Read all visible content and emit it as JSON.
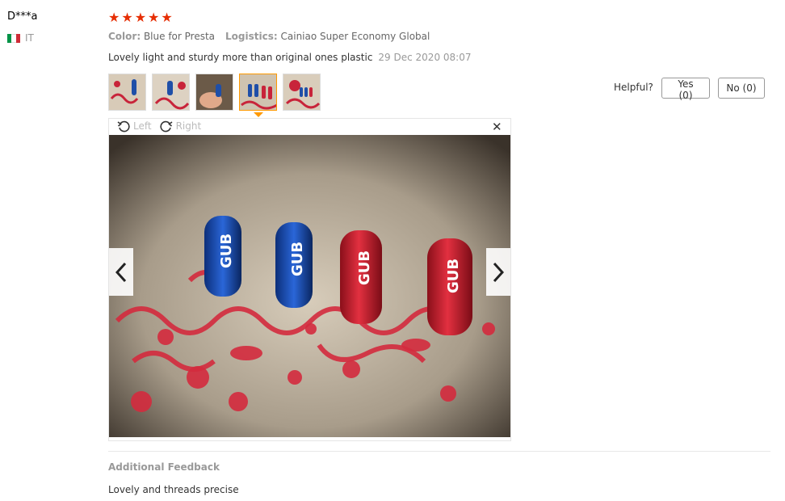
{
  "reviewer": {
    "name": "D***a",
    "country": "IT",
    "flag_colors": [
      "#009246",
      "#ffffff",
      "#ce2b37"
    ]
  },
  "rating": {
    "stars": 5,
    "star_glyph": "★",
    "color": "#e62e04"
  },
  "meta": {
    "color_label": "Color:",
    "color_value": "Blue for Presta",
    "logistics_label": "Logistics:",
    "logistics_value": "Cainiao Super Economy Global"
  },
  "review": {
    "text": "Lovely light and sturdy more than original ones plastic",
    "date": "29 Dec 2020 08:07"
  },
  "thumbnails": {
    "count": 5,
    "active_index": 3
  },
  "helpful": {
    "label": "Helpful?",
    "yes": "Yes (0)",
    "no": "No (0)"
  },
  "viewer": {
    "rotate_left": "Left",
    "rotate_right": "Right",
    "close": "✕",
    "prev": "‹",
    "next": "›"
  },
  "additional": {
    "title": "Additional Feedback",
    "text": "Lovely and threads precise"
  },
  "colors": {
    "accent": "#e62e04",
    "active_border": "#ff9900"
  }
}
